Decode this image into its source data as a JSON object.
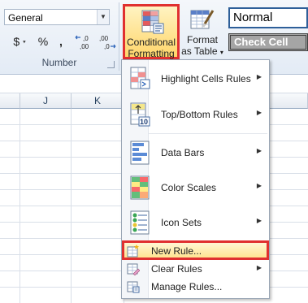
{
  "ribbon": {
    "number_format": "General",
    "currency_symbol": "$",
    "percent_symbol": "%",
    "comma_symbol": ",",
    "increase_decimal": "←.0 .00",
    "decrease_decimal": ".00 →.0",
    "number_group_label": "Number",
    "conditional_formatting": {
      "line1": "Conditional",
      "line2": "Formatting",
      "arrow": "▾"
    },
    "format_as_table": {
      "line1": "Format",
      "line2": "as Table",
      "arrow": "▾"
    },
    "style_normal": "Normal",
    "style_check_cell": "Check Cell"
  },
  "sheet": {
    "columns": [
      "J",
      "K"
    ]
  },
  "menu": {
    "items": [
      {
        "label": "Highlight Cells Rules",
        "icon": "highlight-cells-icon"
      },
      {
        "label": "Top/Bottom Rules",
        "icon": "top-bottom-icon"
      },
      {
        "label": "Data Bars",
        "icon": "data-bars-icon"
      },
      {
        "label": "Color Scales",
        "icon": "color-scales-icon"
      },
      {
        "label": "Icon Sets",
        "icon": "icon-sets-icon"
      }
    ],
    "small_items": [
      {
        "label": "New Rule...",
        "icon": "new-rule-icon"
      },
      {
        "label": "Clear Rules",
        "icon": "clear-rules-icon"
      },
      {
        "label": "Manage Rules...",
        "icon": "manage-rules-icon"
      }
    ],
    "submenu_arrow": "▶",
    "top_bottom_number": "10"
  },
  "colors": {
    "highlight_border": "#e03030",
    "hover_fill": "#ffe38a"
  }
}
